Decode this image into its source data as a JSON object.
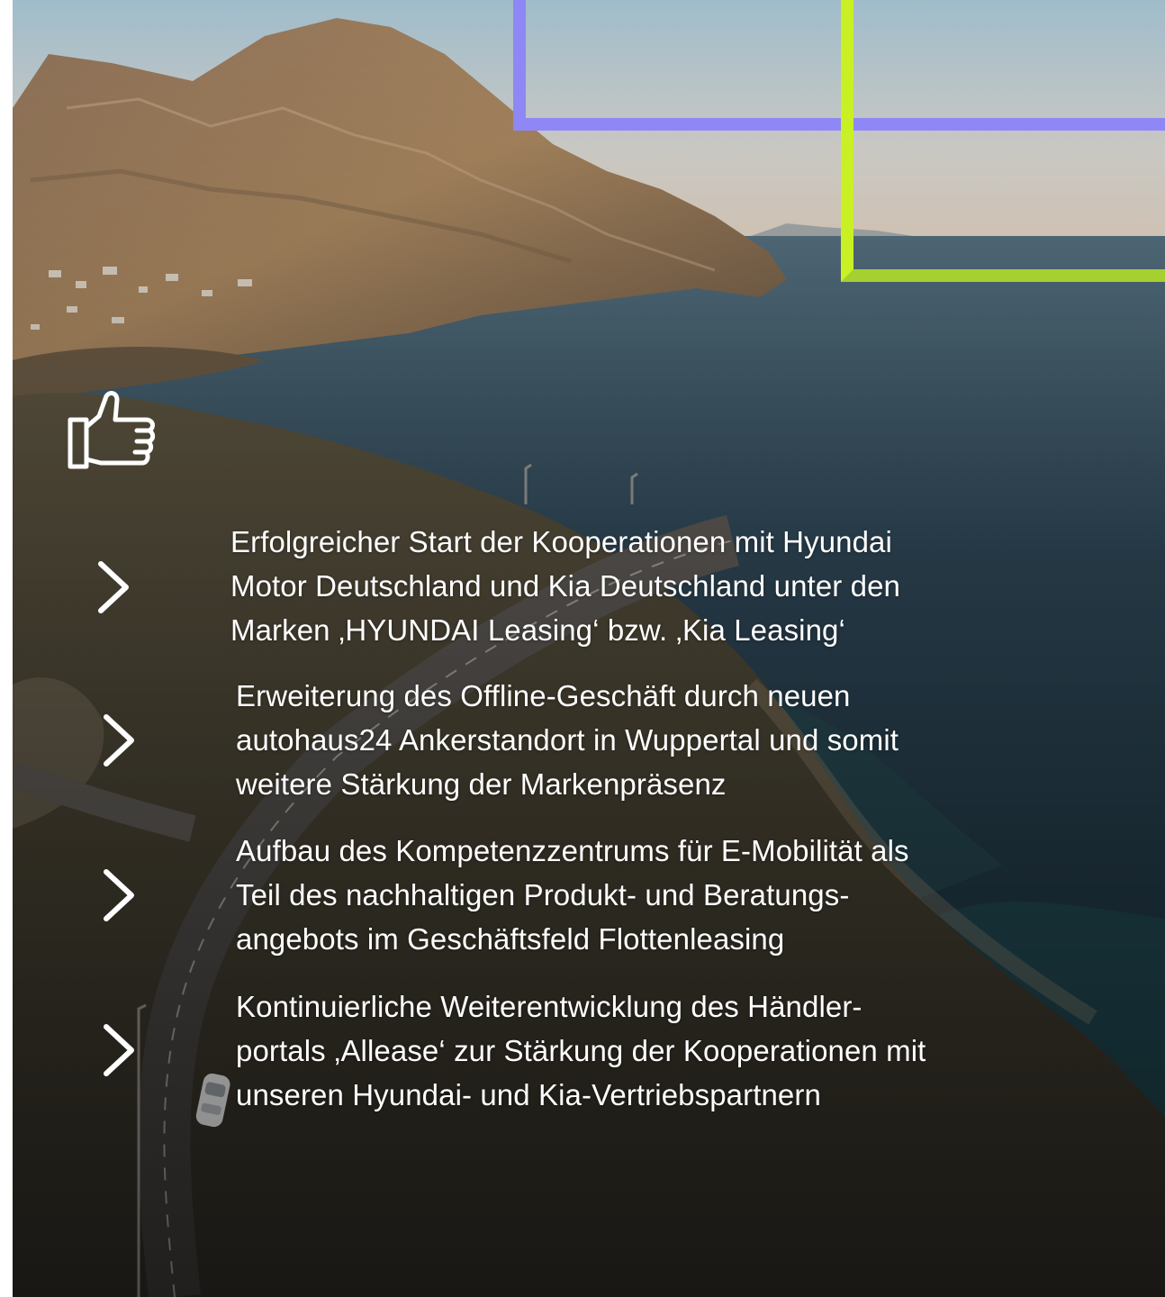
{
  "colors": {
    "frame_purple": "#8f87f5",
    "frame_green": "#c8f025",
    "text": "#ffffff"
  },
  "icons": {
    "header": "thumbs-up-icon",
    "bullet": "chevron-right-icon"
  },
  "bullets": [
    {
      "text": "Erfolgreicher Start der Kooperationen mit Hyundai\nMotor Deutschland und Kia Deutschland unter den\nMarken ‚HYUNDAI Leasing‘ bzw. ‚Kia Leasing‘"
    },
    {
      "text": "Erweiterung des Offline-Geschäft durch neuen\nautohaus24 Ankerstandort in Wuppertal und somit\nweitere Stärkung der Markenpräsenz"
    },
    {
      "text": "Aufbau des Kompetenzzentrums für E-Mobilität als\nTeil des nachhaltigen Produkt- und Beratungs-\nangebots im Geschäftsfeld Flottenleasing"
    },
    {
      "text": "Kontinuierliche Weiterentwicklung des Händler-\nportals ‚Allease‘ zur Stärkung der Kooperationen mit\nunseren Hyundai- und Kia-Vertriebspartnern"
    }
  ]
}
